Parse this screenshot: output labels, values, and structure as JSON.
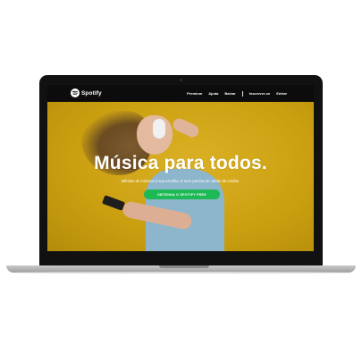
{
  "header": {
    "brand": "Spotify",
    "nav": [
      {
        "label": "Premium"
      },
      {
        "label": "Ajuda"
      },
      {
        "label": "Baixar"
      },
      {
        "label": "Inscrever-se"
      },
      {
        "label": "Entrar"
      }
    ]
  },
  "hero": {
    "headline": "Música para todos.",
    "subtitle": "Milhões de músicas à sua escolha. E nem precisa de cartão de crédito.",
    "cta_label": "OBTENHA O SPOTIFY FREE"
  },
  "colors": {
    "brand_green": "#1DB954",
    "hero_background": "#CFA413",
    "navbar": "#0C0C0C"
  },
  "icons": {
    "logo": "spotify-logo-icon"
  }
}
